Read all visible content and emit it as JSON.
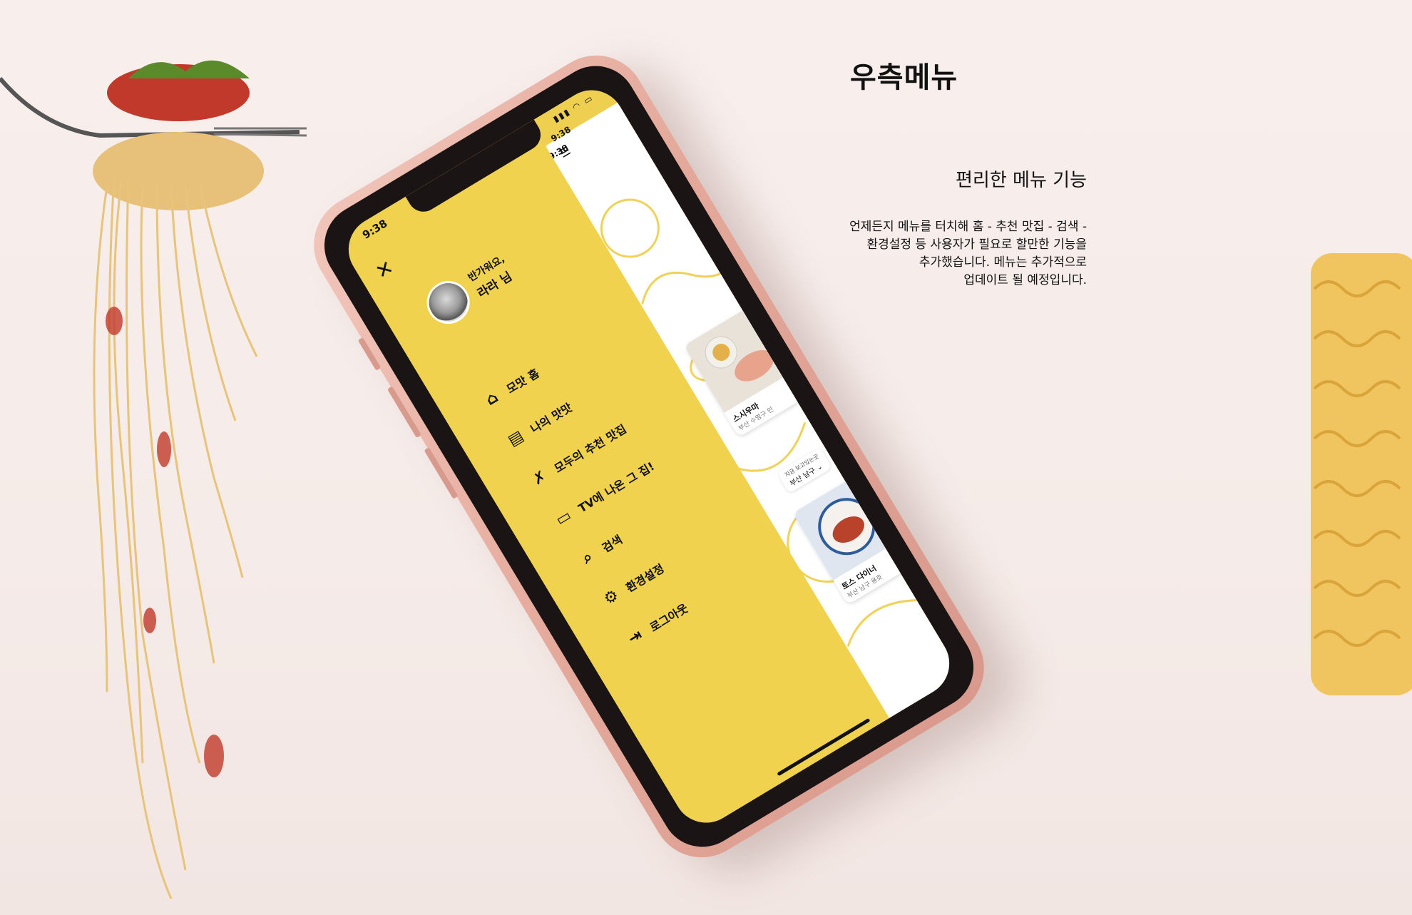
{
  "header": {
    "title": "우측메뉴",
    "subtitle": "편리한 메뉴 기능",
    "description_lines": [
      "언제든지 메뉴를 터치해 홈 - 추천 맛집 - 검색 -",
      "환경설정 등 사용자가 필요로 할만한 기능을",
      "추가했습니다. 메뉴는 추가적으로",
      "업데이트 될 예정입니다."
    ]
  },
  "phone": {
    "status_time": "9:38",
    "greeting": "반가워요,",
    "username": "라라 님",
    "menu_items": [
      {
        "label": "모맛 홈",
        "icon": "home-icon"
      },
      {
        "label": "나의 맛맛",
        "icon": "notebook-icon"
      },
      {
        "label": "모두의 추천 맛집",
        "icon": "utensils-icon"
      },
      {
        "label": "TV에 나온 그 집!",
        "icon": "tv-icon"
      },
      {
        "label": "검색",
        "icon": "search-icon"
      },
      {
        "label": "환경설정",
        "icon": "gear-icon"
      },
      {
        "label": "로그아웃",
        "icon": "logout-icon"
      }
    ],
    "background_screen": {
      "time_a": "9:38",
      "time_b": "9:38",
      "card_1": {
        "title": "스시우마",
        "sub": "부산 수영구 민"
      },
      "location_note": "지금 보고있는곳",
      "location": "부산 남구",
      "card_2": {
        "title": "토스 다이너",
        "sub": "부산 남구 용호"
      }
    }
  },
  "colors": {
    "menu_yellow": "#f1d24f",
    "phone_pink": "#e4a99b",
    "background": "#f7eeec"
  }
}
